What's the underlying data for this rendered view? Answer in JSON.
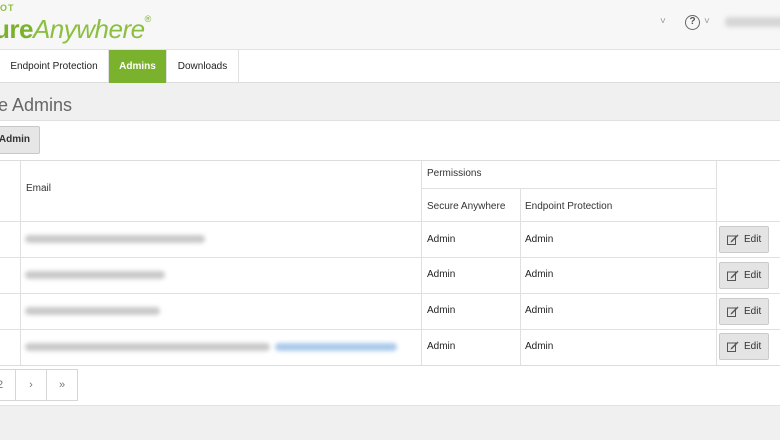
{
  "header": {
    "logo_small": "OT",
    "logo_strong": "ure",
    "logo_light": "Anywhere",
    "logo_mark": "®",
    "chevron": "˅",
    "help_icon_glyph": "?",
    "help_chevron": "˅"
  },
  "nav": {
    "tabs": [
      {
        "label": "Endpoint Protection",
        "active": false
      },
      {
        "label": "Admins",
        "active": true
      },
      {
        "label": "Downloads",
        "active": false
      }
    ]
  },
  "page": {
    "title": "ge Admins"
  },
  "toolbar": {
    "add_label": "Admin"
  },
  "table": {
    "headers": {
      "email": "Email",
      "permissions": "Permissions",
      "secure_anywhere": "Secure Anywhere",
      "endpoint_protection": "Endpoint Protection"
    },
    "rows": [
      {
        "secure_anywhere": "Admin",
        "endpoint_protection": "Admin",
        "edit_label": "Edit"
      },
      {
        "secure_anywhere": "Admin",
        "endpoint_protection": "Admin",
        "edit_label": "Edit"
      },
      {
        "secure_anywhere": "Admin",
        "endpoint_protection": "Admin",
        "edit_label": "Edit"
      },
      {
        "secure_anywhere": "Admin",
        "endpoint_protection": "Admin",
        "edit_label": "Edit"
      }
    ]
  },
  "pagination": {
    "items": [
      "2",
      "›",
      "»"
    ]
  },
  "colors": {
    "brand_green": "#7ab22e",
    "link_blue": "#a9c9ea"
  }
}
